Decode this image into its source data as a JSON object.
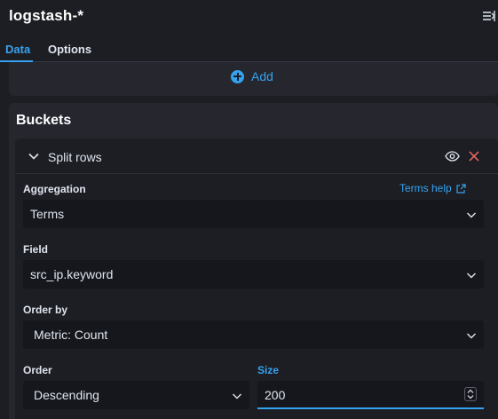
{
  "header": {
    "title": "logstash-*",
    "collapse_icon": "menu-collapse-right-icon"
  },
  "tabs": [
    {
      "label": "Data",
      "active": true
    },
    {
      "label": "Options",
      "active": false
    }
  ],
  "metrics_panel": {
    "add_label": "Add",
    "add_icon": "plus-circle-icon"
  },
  "buckets": {
    "title": "Buckets",
    "agg": {
      "name": "Split rows",
      "aggregation_label": "Aggregation",
      "help_link": "Terms help",
      "aggregation_value": "Terms",
      "field_label": "Field",
      "field_value": "src_ip.keyword",
      "order_by_label": "Order by",
      "order_by_value": "Metric: Count",
      "order_label": "Order",
      "order_value": "Descending",
      "size_label": "Size",
      "size_value": "200"
    }
  },
  "colors": {
    "accent": "#36a2ef",
    "background": "#1d1e24",
    "panel": "#25262e",
    "input": "#16171c",
    "danger": "#f86b63"
  }
}
